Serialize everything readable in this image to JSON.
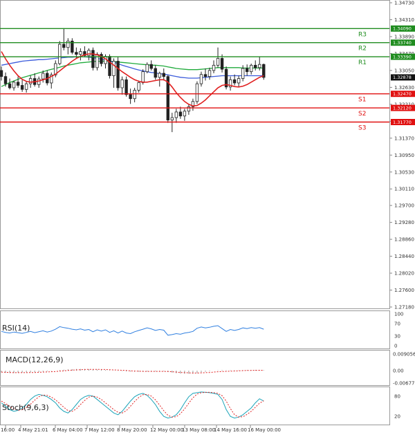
{
  "chart_data": [
    {
      "type": "candlestick",
      "y_ticks": [
        "1.34730",
        "1.34310",
        "1.33890",
        "1.33470",
        "1.33050",
        "1.32630",
        "1.32210",
        "1.31790",
        "1.31370",
        "1.30950",
        "1.30530",
        "1.30110",
        "1.29700",
        "1.29280",
        "1.28860",
        "1.28440",
        "1.28020",
        "1.27600",
        "1.27180"
      ],
      "x_ticks": [
        "16:00",
        "4 May 21:01",
        "6 May 04:00",
        "7 May 12:00",
        "8 May 20:00",
        "12 May 00:00",
        "13 May 08:00",
        "14 May 16:00",
        "16 May 00:00"
      ],
      "ylim": [
        1.2718,
        1.3473
      ],
      "levels": [
        {
          "name": "R3",
          "value": 1.3409,
          "badge": "1.34090",
          "color": "#1f8c1f"
        },
        {
          "name": "R2",
          "value": 1.3374,
          "badge": "1.33740",
          "color": "#1f8c1f"
        },
        {
          "name": "R1",
          "value": 1.3339,
          "badge": "1.33390",
          "color": "#1f8c1f"
        },
        {
          "name": "S1",
          "value": 1.3247,
          "badge": "1.32470",
          "color": "#e01010"
        },
        {
          "name": "S2",
          "value": 1.3212,
          "badge": "1.32120",
          "color": "#e01010"
        },
        {
          "name": "S3",
          "value": 1.3177,
          "badge": "1.31770",
          "color": "#e01010"
        }
      ],
      "current_price": {
        "value": 1.32878,
        "badge": "1.32878"
      },
      "candles": [
        [
          1.3305,
          1.3315,
          1.328,
          1.329
        ],
        [
          1.329,
          1.33,
          1.3265,
          1.3272
        ],
        [
          1.3272,
          1.3285,
          1.3258,
          1.3262
        ],
        [
          1.3262,
          1.328,
          1.3255,
          1.3276
        ],
        [
          1.3276,
          1.329,
          1.3262,
          1.3268
        ],
        [
          1.3268,
          1.3282,
          1.3252,
          1.3258
        ],
        [
          1.3258,
          1.3278,
          1.325,
          1.3272
        ],
        [
          1.3272,
          1.3292,
          1.3262,
          1.3285
        ],
        [
          1.3285,
          1.3298,
          1.3265,
          1.327
        ],
        [
          1.327,
          1.329,
          1.3262,
          1.3284
        ],
        [
          1.3284,
          1.3305,
          1.3275,
          1.3298
        ],
        [
          1.3298,
          1.3305,
          1.3268,
          1.3274
        ],
        [
          1.3274,
          1.33,
          1.326,
          1.3294
        ],
        [
          1.3294,
          1.333,
          1.3288,
          1.3322
        ],
        [
          1.3322,
          1.3378,
          1.3318,
          1.337
        ],
        [
          1.337,
          1.341,
          1.3355,
          1.3362
        ],
        [
          1.3362,
          1.3385,
          1.3345,
          1.3378
        ],
        [
          1.3378,
          1.3385,
          1.3345,
          1.335
        ],
        [
          1.335,
          1.3362,
          1.3335,
          1.3345
        ],
        [
          1.3345,
          1.336,
          1.333,
          1.3352
        ],
        [
          1.3352,
          1.3365,
          1.3338,
          1.3342
        ],
        [
          1.3342,
          1.336,
          1.333,
          1.3355
        ],
        [
          1.3355,
          1.3362,
          1.3305,
          1.3312
        ],
        [
          1.3312,
          1.335,
          1.3305,
          1.3345
        ],
        [
          1.3345,
          1.335,
          1.3315,
          1.3322
        ],
        [
          1.3322,
          1.3345,
          1.331,
          1.334
        ],
        [
          1.334,
          1.3345,
          1.3285,
          1.3292
        ],
        [
          1.3292,
          1.3335,
          1.3262,
          1.3328
        ],
        [
          1.3328,
          1.3338,
          1.3255,
          1.3262
        ],
        [
          1.3262,
          1.329,
          1.3245,
          1.3282
        ],
        [
          1.3282,
          1.329,
          1.324,
          1.3245
        ],
        [
          1.3245,
          1.326,
          1.3222,
          1.3235
        ],
        [
          1.3235,
          1.3262,
          1.3226,
          1.3256
        ],
        [
          1.3256,
          1.328,
          1.325,
          1.3275
        ],
        [
          1.3275,
          1.3308,
          1.327,
          1.3302
        ],
        [
          1.3302,
          1.3325,
          1.3298,
          1.332
        ],
        [
          1.332,
          1.333,
          1.3305,
          1.331
        ],
        [
          1.331,
          1.3318,
          1.3282,
          1.3288
        ],
        [
          1.3288,
          1.3302,
          1.3265,
          1.3298
        ],
        [
          1.3298,
          1.331,
          1.328,
          1.329
        ],
        [
          1.329,
          1.3294,
          1.3175,
          1.3182
        ],
        [
          1.3182,
          1.32,
          1.3152,
          1.3188
        ],
        [
          1.3188,
          1.321,
          1.3175,
          1.3202
        ],
        [
          1.3202,
          1.3215,
          1.3185,
          1.3192
        ],
        [
          1.3192,
          1.321,
          1.318,
          1.3204
        ],
        [
          1.3204,
          1.322,
          1.3195,
          1.3215
        ],
        [
          1.3215,
          1.3235,
          1.3205,
          1.3228
        ],
        [
          1.3228,
          1.3278,
          1.3222,
          1.3272
        ],
        [
          1.3272,
          1.3302,
          1.3265,
          1.3295
        ],
        [
          1.3295,
          1.331,
          1.328,
          1.329
        ],
        [
          1.329,
          1.3312,
          1.3282,
          1.3305
        ],
        [
          1.3305,
          1.333,
          1.3298,
          1.3318
        ],
        [
          1.3318,
          1.3362,
          1.3312,
          1.3335
        ],
        [
          1.3335,
          1.3345,
          1.33,
          1.3308
        ],
        [
          1.3308,
          1.3315,
          1.3258,
          1.3264
        ],
        [
          1.3264,
          1.329,
          1.3255,
          1.3282
        ],
        [
          1.3282,
          1.3295,
          1.3268,
          1.3274
        ],
        [
          1.3274,
          1.3292,
          1.3265,
          1.3285
        ],
        [
          1.3285,
          1.3318,
          1.3278,
          1.331
        ],
        [
          1.331,
          1.332,
          1.3292,
          1.3302
        ],
        [
          1.3302,
          1.3322,
          1.3295,
          1.3318
        ],
        [
          1.3318,
          1.333,
          1.3305,
          1.3312
        ],
        [
          1.3312,
          1.334,
          1.3305,
          1.332
        ],
        [
          1.332,
          1.3322,
          1.3282,
          1.32878
        ]
      ],
      "ma_fast": [
        1.3352,
        1.3334,
        1.3318,
        1.3304,
        1.3292,
        1.3283,
        1.3278,
        1.3276,
        1.3277,
        1.3279,
        1.3282,
        1.3285,
        1.329,
        1.3296,
        1.3304,
        1.3312,
        1.332,
        1.3328,
        1.3335,
        1.334,
        1.3344,
        1.3346,
        1.3346,
        1.3344,
        1.334,
        1.3334,
        1.3326,
        1.3318,
        1.331,
        1.3302,
        1.3295,
        1.3288,
        1.3282,
        1.3278,
        1.3276,
        1.3276,
        1.3278,
        1.328,
        1.3282,
        1.3282,
        1.3276,
        1.3264,
        1.325,
        1.3238,
        1.3228,
        1.3221,
        1.3217,
        1.3218,
        1.3224,
        1.3232,
        1.3242,
        1.3252,
        1.3262,
        1.3268,
        1.327,
        1.3268,
        1.3265,
        1.3264,
        1.3266,
        1.327,
        1.3276,
        1.3282,
        1.3288,
        1.3292
      ],
      "ma_mid": [
        1.3318,
        1.332,
        1.3322,
        1.3324,
        1.3326,
        1.3328,
        1.3329,
        1.333,
        1.3331,
        1.3332,
        1.3332,
        1.3333,
        1.3334,
        1.3335,
        1.3336,
        1.3337,
        1.3338,
        1.3338,
        1.3339,
        1.3339,
        1.3339,
        1.3338,
        1.3337,
        1.3335,
        1.3333,
        1.3331,
        1.3328,
        1.3325,
        1.3322,
        1.3318,
        1.3315,
        1.3312,
        1.3309,
        1.3306,
        1.3304,
        1.3302,
        1.33,
        1.3299,
        1.3297,
        1.3296,
        1.3294,
        1.3292,
        1.329,
        1.3288,
        1.3287,
        1.3286,
        1.3286,
        1.3286,
        1.3287,
        1.3288,
        1.3289,
        1.329,
        1.3291,
        1.3292,
        1.3292,
        1.3292,
        1.3292,
        1.3292,
        1.3292,
        1.3292,
        1.3292,
        1.3292,
        1.3292,
        1.3292
      ],
      "ma_slow": [
        1.3265,
        1.327,
        1.3275,
        1.3279,
        1.3283,
        1.3287,
        1.329,
        1.3293,
        1.3296,
        1.3299,
        1.3302,
        1.3305,
        1.3308,
        1.331,
        1.3313,
        1.3316,
        1.3318,
        1.332,
        1.3322,
        1.3324,
        1.3325,
        1.3326,
        1.3327,
        1.3328,
        1.3328,
        1.3328,
        1.3328,
        1.3327,
        1.3326,
        1.3325,
        1.3324,
        1.3323,
        1.3322,
        1.3321,
        1.332,
        1.3319,
        1.3318,
        1.3318,
        1.3317,
        1.3316,
        1.3314,
        1.3312,
        1.331,
        1.3309,
        1.3308,
        1.3307,
        1.3307,
        1.3307,
        1.3308,
        1.3309,
        1.331,
        1.3311,
        1.3312,
        1.3312,
        1.3312,
        1.3312,
        1.3312,
        1.3312,
        1.3311,
        1.3311,
        1.3311,
        1.3311,
        1.3311,
        1.3311
      ]
    },
    {
      "type": "line",
      "title": "RSI(14)",
      "y_ticks": [
        "100",
        "70",
        "30",
        "0"
      ],
      "ylim": [
        0,
        100
      ],
      "values": [
        45,
        42,
        40,
        43,
        41,
        39,
        42,
        45,
        41,
        44,
        47,
        43,
        46,
        52,
        60,
        57,
        55,
        52,
        50,
        53,
        49,
        51,
        44,
        50,
        46,
        50,
        42,
        47,
        40,
        46,
        40,
        38,
        44,
        48,
        52,
        56,
        53,
        48,
        51,
        49,
        33,
        35,
        38,
        36,
        40,
        42,
        45,
        55,
        59,
        56,
        58,
        61,
        63,
        54,
        45,
        51,
        48,
        51,
        56,
        54,
        57,
        55,
        57,
        52
      ]
    },
    {
      "type": "line",
      "title": "MACD(12,26,9)",
      "y_ticks": [
        "0.009056",
        "0.00",
        "-0.006777"
      ],
      "ylim": [
        -0.006777,
        0.009056
      ],
      "histogram": [
        -0.001,
        -0.0012,
        -0.0013,
        -0.0013,
        -0.0012,
        -0.0011,
        -0.001,
        -0.0009,
        -0.0008,
        -0.0007,
        -0.0005,
        -0.0004,
        -0.0002,
        0.0,
        0.0003,
        0.0005,
        0.0007,
        0.0008,
        0.0009,
        0.0009,
        0.0009,
        0.0008,
        0.0007,
        0.0006,
        0.0005,
        0.0004,
        0.0002,
        0.0001,
        -0.0001,
        -0.0002,
        -0.0004,
        -0.0005,
        -0.0006,
        -0.0006,
        -0.0006,
        -0.0005,
        -0.0004,
        -0.0004,
        -0.0003,
        -0.0003,
        -0.0007,
        -0.0011,
        -0.0014,
        -0.0016,
        -0.0017,
        -0.0017,
        -0.0016,
        -0.0013,
        -0.0009,
        -0.0006,
        -0.0003,
        0.0,
        0.0002,
        0.0003,
        0.0002,
        0.0002,
        0.0002,
        0.0002,
        0.0003,
        0.0003,
        0.0004,
        0.0004,
        0.0004,
        0.0003
      ],
      "signal": [
        -0.0008,
        -0.0009,
        -0.001,
        -0.0011,
        -0.0011,
        -0.0011,
        -0.0011,
        -0.001,
        -0.001,
        -0.0009,
        -0.0008,
        -0.0007,
        -0.0006,
        -0.0005,
        -0.0003,
        -0.0001,
        0.0001,
        0.0003,
        0.0004,
        0.0005,
        0.0006,
        0.0007,
        0.0007,
        0.0007,
        0.0006,
        0.0006,
        0.0005,
        0.0004,
        0.0003,
        0.0002,
        0.0001,
        -0.0001,
        -0.0002,
        -0.0003,
        -0.0004,
        -0.0004,
        -0.0004,
        -0.0004,
        -0.0004,
        -0.0004,
        -0.0005,
        -0.0006,
        -0.0008,
        -0.001,
        -0.0011,
        -0.0012,
        -0.0013,
        -0.0013,
        -0.0012,
        -0.0011,
        -0.001,
        -0.0008,
        -0.0006,
        -0.0005,
        -0.0004,
        -0.0003,
        -0.0002,
        -0.0001,
        0.0,
        0.0001,
        0.0001,
        0.0002,
        0.0002,
        0.0002
      ]
    },
    {
      "type": "line",
      "title": "Stoch(9,6,3)",
      "y_ticks": [
        "80",
        "20"
      ],
      "ylim": [
        0,
        100
      ],
      "k": [
        60,
        50,
        40,
        35,
        38,
        45,
        55,
        70,
        80,
        85,
        82,
        78,
        70,
        60,
        45,
        35,
        30,
        40,
        55,
        70,
        78,
        82,
        80,
        70,
        60,
        50,
        40,
        30,
        25,
        35,
        50,
        65,
        78,
        85,
        88,
        82,
        70,
        55,
        35,
        20,
        15,
        18,
        25,
        40,
        60,
        78,
        88,
        90,
        92,
        91,
        90,
        88,
        85,
        70,
        40,
        20,
        15,
        18,
        25,
        35,
        45,
        60,
        72,
        65
      ],
      "d": [
        65,
        58,
        50,
        42,
        38,
        40,
        46,
        56,
        68,
        78,
        83,
        82,
        77,
        69,
        58,
        47,
        37,
        35,
        42,
        55,
        67,
        77,
        80,
        77,
        70,
        60,
        50,
        40,
        32,
        30,
        37,
        50,
        64,
        76,
        84,
        85,
        80,
        69,
        53,
        37,
        23,
        18,
        19,
        28,
        42,
        59,
        75,
        86,
        90,
        91,
        91,
        90,
        88,
        81,
        65,
        43,
        25,
        18,
        19,
        26,
        35,
        47,
        59,
        66
      ]
    }
  ]
}
